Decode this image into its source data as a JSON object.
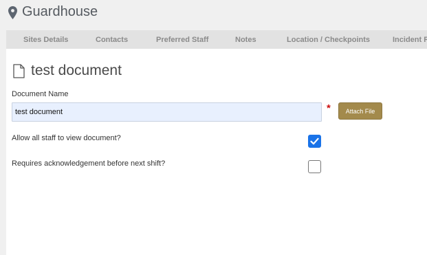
{
  "header": {
    "title": "Guardhouse",
    "icon": "map-pin-icon"
  },
  "tabs": [
    {
      "label": "Sites Details"
    },
    {
      "label": "Contacts"
    },
    {
      "label": "Preferred Staff"
    },
    {
      "label": "Notes"
    },
    {
      "label": "Location / Checkpoints"
    },
    {
      "label": "Incident Re"
    }
  ],
  "document": {
    "icon": "document-icon",
    "title": "test document",
    "name_label": "Document Name",
    "name_value": "test document",
    "required_marker": "*",
    "attach_label": "Attach File"
  },
  "options": {
    "allow_staff_label": "Allow all staff to view document?",
    "allow_staff_checked": true,
    "acknowledge_label": "Requires acknowledgement before next shift?",
    "acknowledge_checked": false
  },
  "colors": {
    "attach_button": "#a38a4c",
    "checkbox_checked": "#1a73e8",
    "required": "#cc1111",
    "input_background": "#e8f0fe"
  }
}
